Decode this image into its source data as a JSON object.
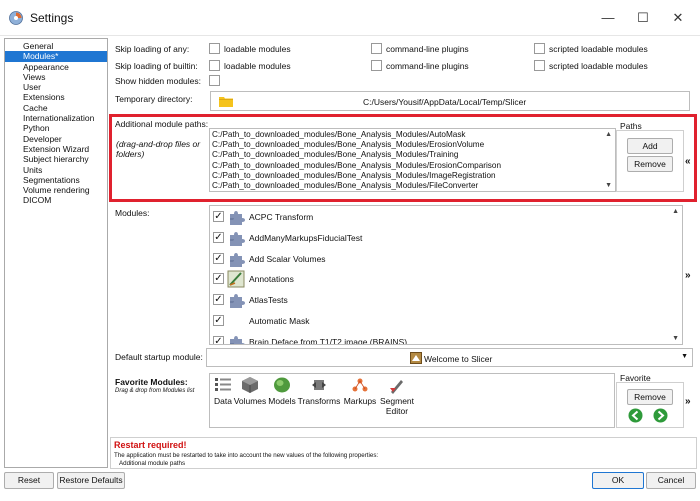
{
  "window": {
    "title": "Settings",
    "minimize_glyph": "—",
    "maximize_glyph": "☐",
    "close_glyph": "✕"
  },
  "sidebar": {
    "items": [
      {
        "label": "General",
        "selected": false
      },
      {
        "label": "Modules*",
        "selected": true
      },
      {
        "label": "Appearance",
        "selected": false
      },
      {
        "label": "Views",
        "selected": false
      },
      {
        "label": "User",
        "selected": false
      },
      {
        "label": "Extensions",
        "selected": false
      },
      {
        "label": "Cache",
        "selected": false
      },
      {
        "label": "Internationalization",
        "selected": false
      },
      {
        "label": "Python",
        "selected": false
      },
      {
        "label": "Developer",
        "selected": false
      },
      {
        "label": "Extension Wizard",
        "selected": false
      },
      {
        "label": "Subject hierarchy",
        "selected": false
      },
      {
        "label": "Units",
        "selected": false
      },
      {
        "label": "Segmentations",
        "selected": false
      },
      {
        "label": "Volume rendering",
        "selected": false
      },
      {
        "label": "DICOM",
        "selected": false
      }
    ]
  },
  "skip_any": {
    "label": "Skip loading of any:",
    "options": [
      "loadable modules",
      "command-line plugins",
      "scripted loadable modules"
    ]
  },
  "skip_builtin": {
    "label": "Skip loading of builtin:",
    "options": [
      "loadable modules",
      "command-line plugins",
      "scripted loadable modules"
    ]
  },
  "show_hidden": {
    "label": "Show hidden modules:"
  },
  "temp_dir": {
    "label": "Temporary directory:",
    "value": "C:/Users/Yousif/AppData/Local/Temp/Slicer"
  },
  "additional_paths": {
    "label": "Additional module paths:",
    "hint": "(drag-and-drop files or folders)",
    "paths_group_label": "Paths",
    "add_label": "Add",
    "remove_label": "Remove",
    "expand_glyph": "«",
    "paths": [
      "C:/Path_to_downloaded_modules/Bone_Analysis_Modules/AutoMask",
      "C:/Path_to_downloaded_modules/Bone_Analysis_Modules/ErosionVolume",
      "C:/Path_to_downloaded_modules/Bone_Analysis_Modules/Training",
      "C:/Path_to_downloaded_modules/Bone_Analysis_Modules/ErosionComparison",
      "C:/Path_to_downloaded_modules/Bone_Analysis_Modules/ImageRegistration",
      "C:/Path_to_downloaded_modules/Bone_Analysis_Modules/FileConverter"
    ]
  },
  "modules": {
    "label": "Modules:",
    "expand_glyph": "»",
    "check_glyph": "✓",
    "items": [
      {
        "name": "ACPC Transform",
        "icon": "puzzle-icon"
      },
      {
        "name": "AddManyMarkupsFiducialTest",
        "icon": "puzzle-icon"
      },
      {
        "name": "Add Scalar Volumes",
        "icon": "puzzle-icon"
      },
      {
        "name": "Annotations",
        "icon": "annotations-icon"
      },
      {
        "name": "AtlasTests",
        "icon": "puzzle-icon"
      },
      {
        "name": "Automatic Mask",
        "icon": "none"
      },
      {
        "name": "Brain Deface from T1/T2 image (BRAINS)",
        "icon": "puzzle-icon"
      }
    ]
  },
  "default_startup": {
    "label": "Default startup module:",
    "value": "Welcome to Slicer"
  },
  "favorites": {
    "label": "Favorite Modules:",
    "hint": "Drag & drop from Modules list",
    "group_label": "Favorite",
    "remove_label": "Remove",
    "expand_glyph": "»",
    "items": [
      "Data",
      "Volumes",
      "Models",
      "Transforms",
      "Markups",
      "Segment Editor"
    ]
  },
  "restart": {
    "title": "Restart required!",
    "message": "The application must be restarted to take into account the new values of the following properties:",
    "property": "Additional module paths"
  },
  "footer": {
    "reset_label": "Reset",
    "restore_label": "Restore Defaults",
    "ok_label": "OK",
    "cancel_label": "Cancel"
  },
  "colors": {
    "selection": "#1f76d2",
    "highlight_frame": "#e0212e",
    "restart_text": "#d01010",
    "folder": "#f5c31c",
    "nav_green": "#2e9a3a"
  }
}
